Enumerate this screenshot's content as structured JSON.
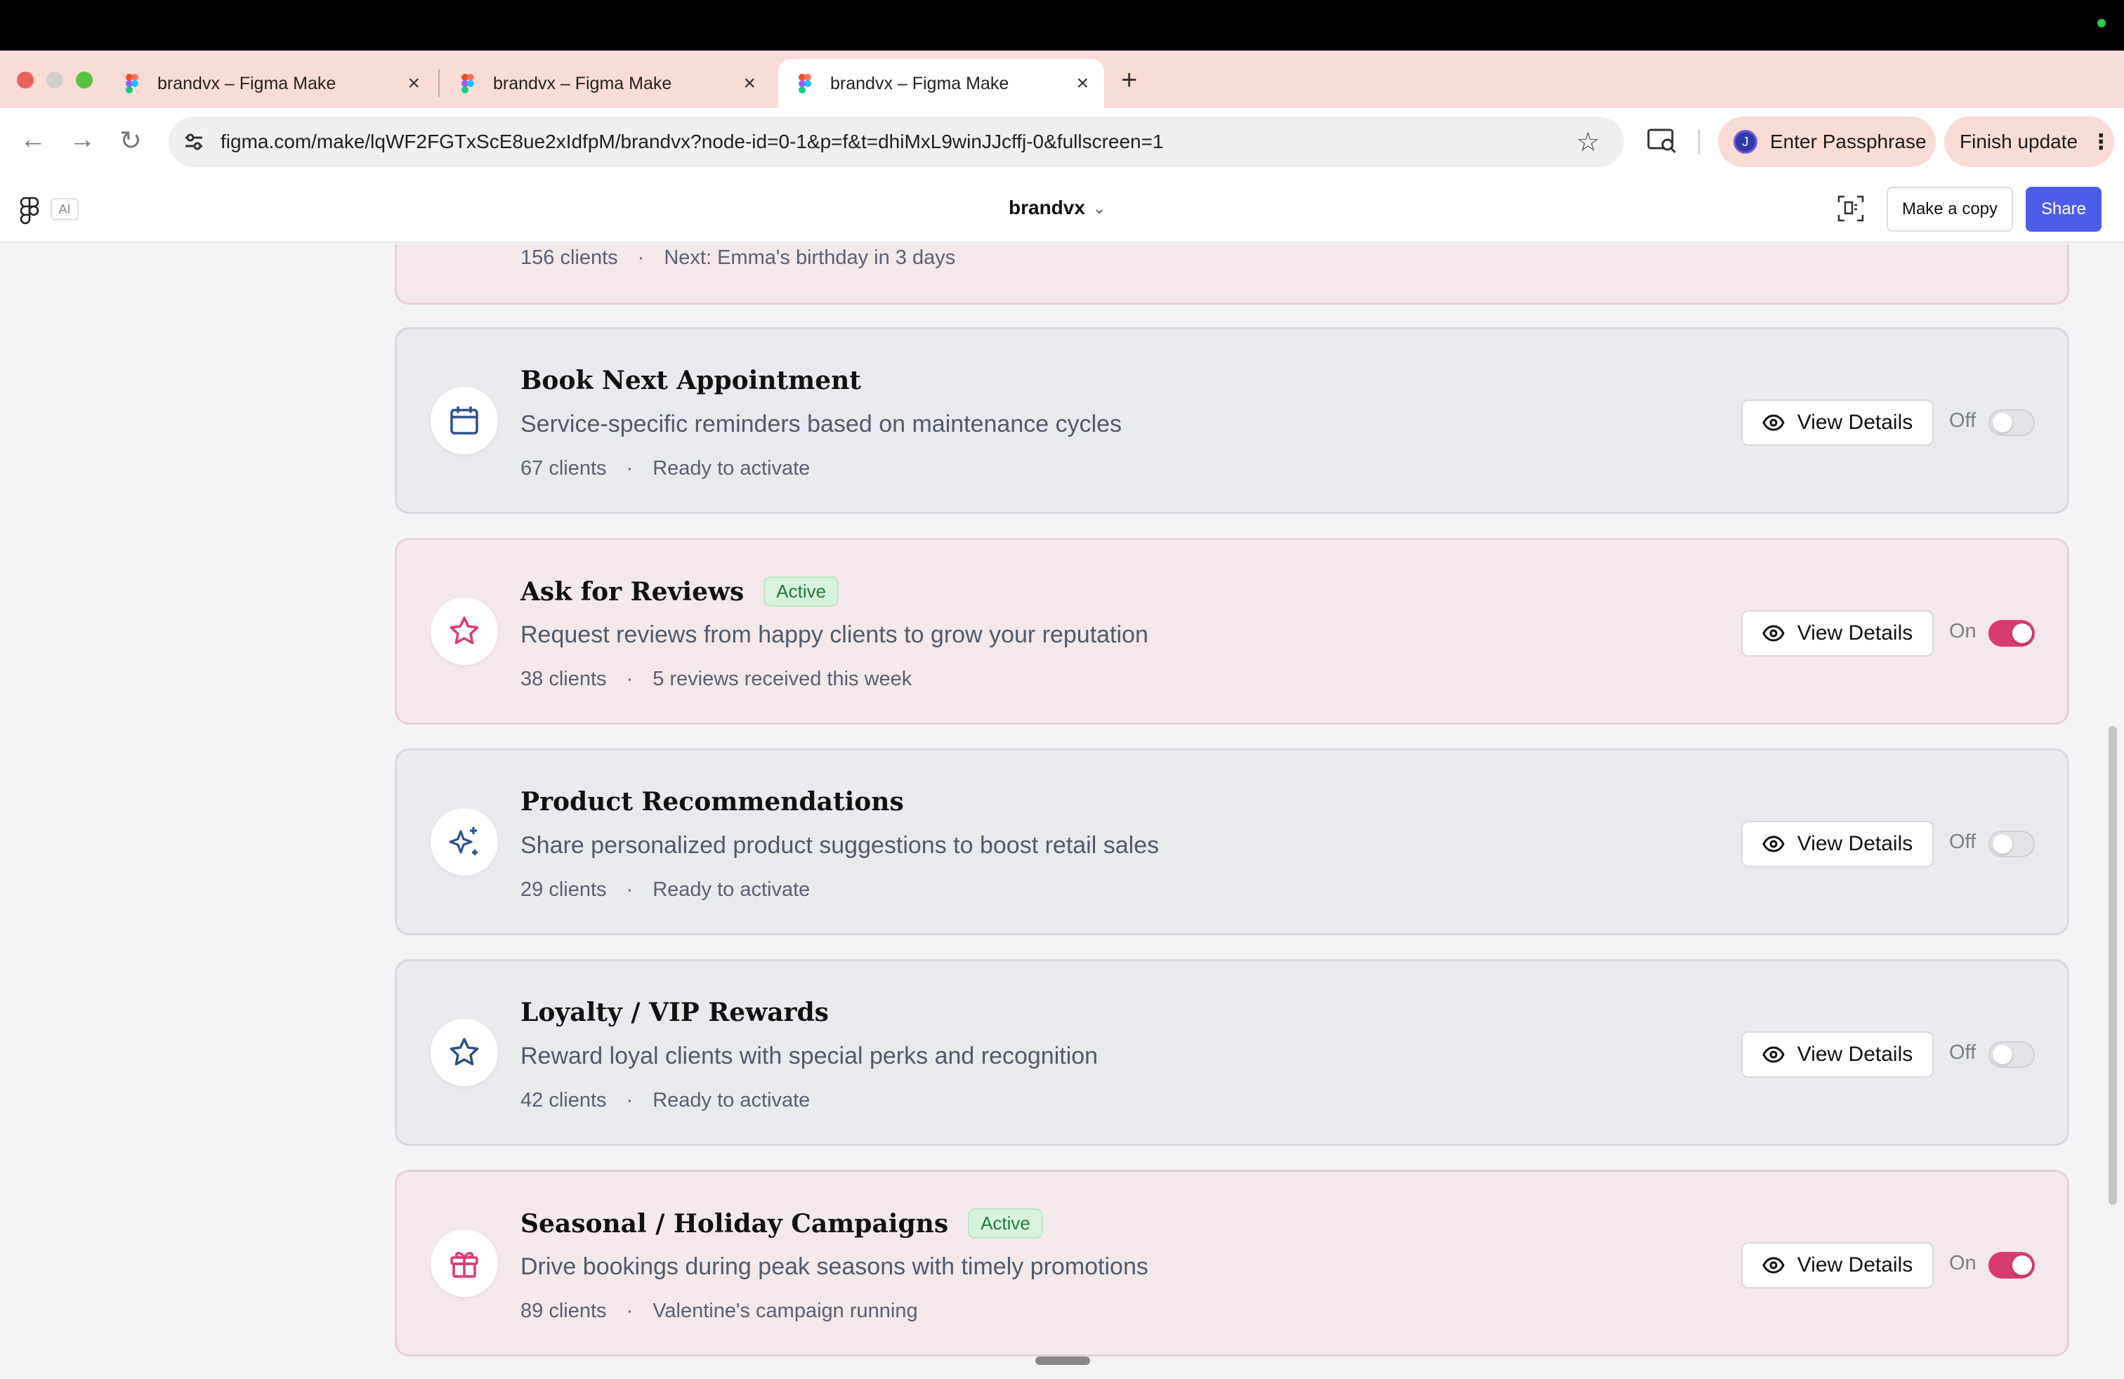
{
  "browser": {
    "tabs": [
      {
        "label": "brandvx – Figma Make",
        "active": false
      },
      {
        "label": "brandvx – Figma Make",
        "active": false
      },
      {
        "label": "brandvx – Figma Make",
        "active": true
      }
    ],
    "url": "figma.com/make/lqWF2FGTxScE8ue2xIdfpM/brandvx?node-id=0-1&p=f&t=dhiMxL9winJJcffj-0&fullscreen=1",
    "profile_initial": "J",
    "profile_label": "Enter Passphrase",
    "update_label": "Finish update"
  },
  "app": {
    "ai_label": "AI",
    "file_title": "brandvx",
    "make_copy_label": "Make a copy",
    "share_label": "Share"
  },
  "top_card": {
    "clients": "156 clients",
    "status": "Next: Emma's birthday in 3 days"
  },
  "cards": [
    {
      "icon": "calendar-icon",
      "title": "Book Next Appointment",
      "badge": "",
      "description": "Service-specific reminders based on maintenance cycles",
      "clients": "67 clients",
      "status": "Ready to activate",
      "button": "View Details",
      "state": "Off",
      "on": false
    },
    {
      "icon": "star-icon",
      "title": "Ask for Reviews",
      "badge": "Active",
      "description": "Request reviews from happy clients to grow your reputation",
      "clients": "38 clients",
      "status": "5 reviews received this week",
      "button": "View Details",
      "state": "On",
      "on": true
    },
    {
      "icon": "sparkles-icon",
      "title": "Product Recommendations",
      "badge": "",
      "description": "Share personalized product suggestions to boost retail sales",
      "clients": "29 clients",
      "status": "Ready to activate",
      "button": "View Details",
      "state": "Off",
      "on": false
    },
    {
      "icon": "star-icon",
      "title": "Loyalty / VIP Rewards",
      "badge": "",
      "description": "Reward loyal clients with special perks and recognition",
      "clients": "42 clients",
      "status": "Ready to activate",
      "button": "View Details",
      "state": "Off",
      "on": false
    },
    {
      "icon": "gift-icon",
      "title": "Seasonal / Holiday Campaigns",
      "badge": "Active",
      "description": "Drive bookings during peak seasons with timely promotions",
      "clients": "89 clients",
      "status": "Valentine's campaign running",
      "button": "View Details",
      "state": "On",
      "on": true
    }
  ],
  "separator": "·",
  "colors": {
    "accent_pink": "#d83a72",
    "icon_blue": "#2d4f8e",
    "share_button": "#4d5ce8",
    "active_badge": "#217a3c"
  }
}
